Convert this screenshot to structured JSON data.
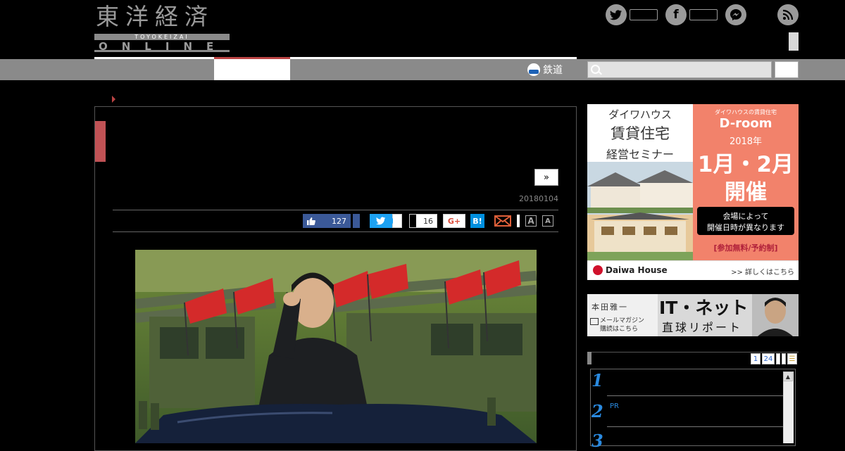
{
  "header": {
    "logo_kanji": "東洋経済",
    "logo_roman": "TOYOKEIZAI",
    "logo_online": "ONLINE",
    "social_icons": [
      "twitter-icon",
      "facebook-icon",
      "messenger-icon",
      "rss-icon"
    ]
  },
  "nav": {
    "rail_label": "鉄道"
  },
  "search": {
    "placeholder": ""
  },
  "article": {
    "next_label": "»",
    "date": "20180104",
    "share": {
      "like_count": "127",
      "fb_count": "16",
      "gplus_label": "G+",
      "hatena_label": "B!",
      "font_large": "A",
      "font_small": "A"
    }
  },
  "ad_daiwa": {
    "left_line1": "ダイワハウス",
    "left_line2": "賃貸住宅",
    "left_line3": "経営セミナー",
    "right_caption": "ダイワハウスの賃貸住宅",
    "right_brand": "D-room",
    "right_year": "2018年",
    "right_dates": "1月・2月",
    "right_held": "開催",
    "right_note1": "会場によって",
    "right_note2": "開催日時が異なります",
    "right_free": "[参加無料/予約制]",
    "logo_text": "Daiwa House",
    "details_link": ">> 詳しくはこちら"
  },
  "ad_mail": {
    "author": "本田雅一",
    "title": "IT・ネット",
    "subtitle": "直球リポート",
    "mail_line1": "メールマガジン",
    "mail_line2": "購読はこちら"
  },
  "ranking": {
    "tabs": [
      "1",
      "24"
    ],
    "tab_icon": "list-icon",
    "items": [
      {
        "rank": "1",
        "label": ""
      },
      {
        "rank": "2",
        "label": "PR"
      },
      {
        "rank": "3",
        "label": ""
      }
    ]
  },
  "colors": {
    "accent_red": "#c05255",
    "nav_gray": "#8a8a8a",
    "facebook": "#3b5998",
    "twitter": "#1da1f2",
    "rank_blue": "#2a8ae0"
  }
}
